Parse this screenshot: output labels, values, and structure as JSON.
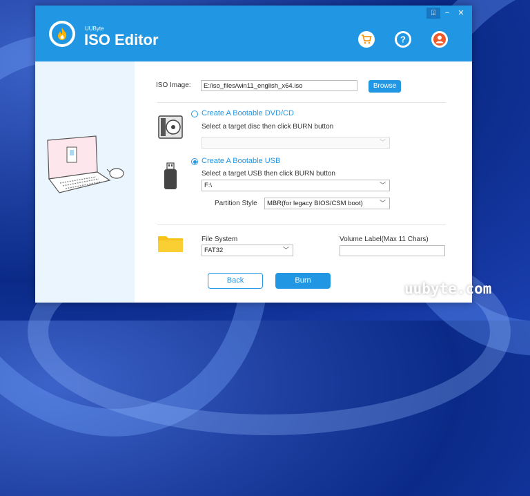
{
  "app": {
    "brand_small": "UUByte",
    "brand_name": "ISO Editor"
  },
  "window_controls": [
    "⍗",
    "−",
    "✕"
  ],
  "header_icons": [
    "cart-icon",
    "help-icon",
    "user-icon"
  ],
  "iso": {
    "label": "ISO Image:",
    "value": "E:/iso_files/win11_english_x64.iso",
    "browse_label": "Browse"
  },
  "dvd": {
    "option_label": "Create A Bootable DVD/CD",
    "hint": "Select a target disc then click BURN button",
    "selected_value": "",
    "checked": false
  },
  "usb": {
    "option_label": "Create A Bootable USB",
    "hint": "Select a target USB then click BURN button",
    "selected_value": "F:\\",
    "checked": true
  },
  "partition": {
    "label": "Partition Style",
    "value": "MBR(for legacy BIOS/CSM boot)"
  },
  "filesystem": {
    "label": "File System",
    "value": "FAT32"
  },
  "volume": {
    "label": "Volume Label(Max 11 Chars)",
    "value": ""
  },
  "actions": {
    "back_label": "Back",
    "burn_label": "Burn"
  },
  "watermark": "uubyte.com",
  "colors": {
    "accent": "#2196e3",
    "left_panel": "#eaf5fd",
    "folder": "#f7c21a",
    "cart": "#f29a1a",
    "user": "#f05a28"
  }
}
